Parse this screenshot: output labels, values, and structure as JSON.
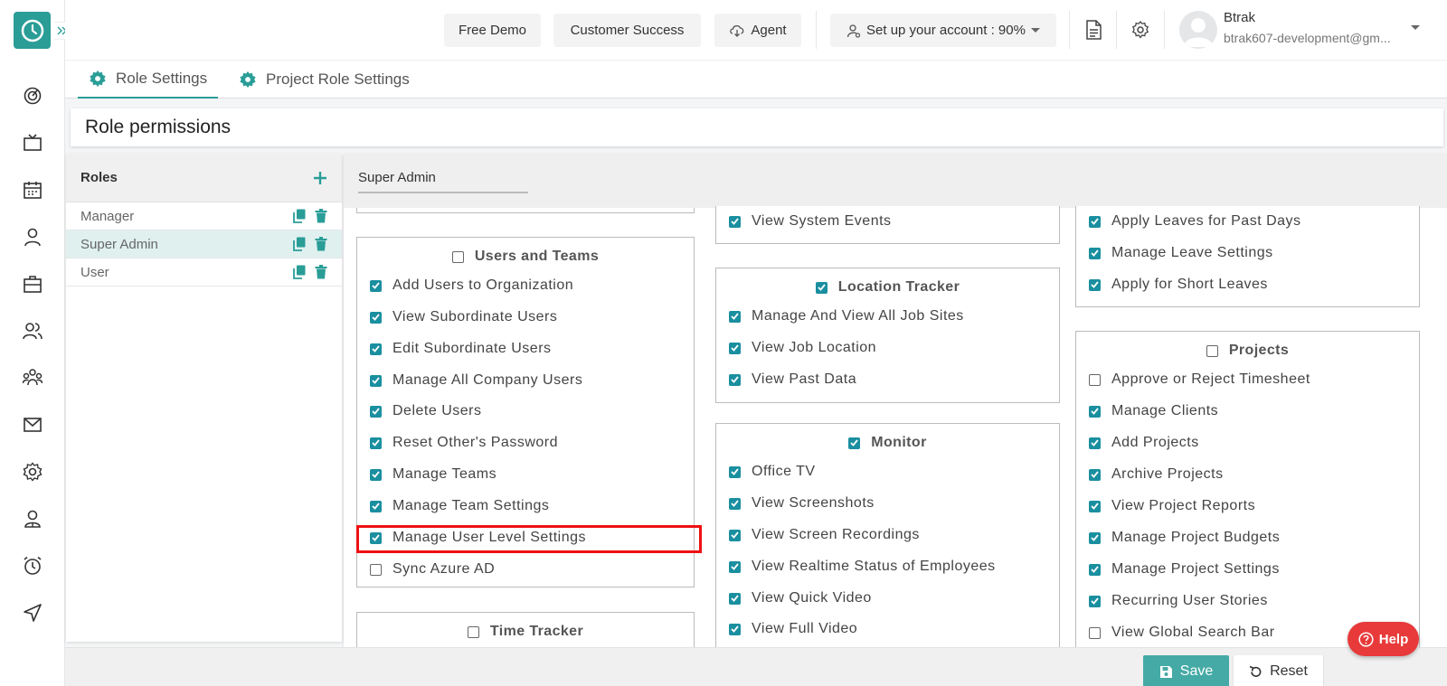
{
  "topbar": {
    "free_demo": "Free Demo",
    "customer_success": "Customer Success",
    "agent": "Agent",
    "setup": "Set up your account : 90%",
    "user_name": "Btrak",
    "user_email": "btrak607-development@gm..."
  },
  "tabs": [
    {
      "label": "Role Settings"
    },
    {
      "label": "Project Role Settings"
    }
  ],
  "page_title": "Role permissions",
  "roles": {
    "title": "Roles",
    "items": [
      {
        "label": "Manager"
      },
      {
        "label": "Super Admin"
      },
      {
        "label": "User"
      }
    ]
  },
  "selected_role": "Super Admin",
  "columns": {
    "col1": {
      "users_teams": {
        "title": "Users and Teams",
        "checked": false,
        "items": [
          {
            "label": "Add Users to Organization",
            "checked": true
          },
          {
            "label": "View Subordinate Users",
            "checked": true
          },
          {
            "label": "Edit Subordinate Users",
            "checked": true
          },
          {
            "label": "Manage All Company Users",
            "checked": true
          },
          {
            "label": "Delete Users",
            "checked": true
          },
          {
            "label": "Reset Other's Password",
            "checked": true
          },
          {
            "label": "Manage Teams",
            "checked": true
          },
          {
            "label": "Manage Team Settings",
            "checked": true
          },
          {
            "label": "Manage User Level Settings",
            "checked": true
          },
          {
            "label": "Sync Azure AD",
            "checked": false
          }
        ]
      },
      "time_tracker": {
        "title": "Time Tracker",
        "checked": false
      }
    },
    "col2": {
      "top_item": {
        "label": "View System Events",
        "checked": true
      },
      "location_tracker": {
        "title": "Location Tracker",
        "checked": true,
        "items": [
          {
            "label": "Manage And View All Job Sites",
            "checked": true
          },
          {
            "label": "View Job Location",
            "checked": true
          },
          {
            "label": "View Past Data",
            "checked": true
          }
        ]
      },
      "monitor": {
        "title": "Monitor",
        "checked": true,
        "items": [
          {
            "label": "Office TV",
            "checked": true
          },
          {
            "label": "View Screenshots",
            "checked": true
          },
          {
            "label": "View Screen Recordings",
            "checked": true
          },
          {
            "label": "View Realtime Status of Employees",
            "checked": true
          },
          {
            "label": "View Quick Video",
            "checked": true
          },
          {
            "label": "View Full Video",
            "checked": true
          }
        ]
      }
    },
    "col3": {
      "top_items": [
        {
          "label": "Apply Leaves for Past Days",
          "checked": true
        },
        {
          "label": "Manage Leave Settings",
          "checked": true
        },
        {
          "label": "Apply for Short Leaves",
          "checked": true
        }
      ],
      "projects": {
        "title": "Projects",
        "checked": false,
        "items": [
          {
            "label": "Approve or Reject Timesheet",
            "checked": false
          },
          {
            "label": "Manage Clients",
            "checked": true
          },
          {
            "label": "Add Projects",
            "checked": true
          },
          {
            "label": "Archive Projects",
            "checked": true
          },
          {
            "label": "View Project Reports",
            "checked": true
          },
          {
            "label": "Manage Project Budgets",
            "checked": true
          },
          {
            "label": "Manage Project Settings",
            "checked": true
          },
          {
            "label": "Recurring User Stories",
            "checked": true
          },
          {
            "label": "View Global Search Bar",
            "checked": false
          }
        ]
      }
    }
  },
  "footer": {
    "save": "Save",
    "reset": "Reset",
    "help": "Help"
  },
  "colors": {
    "accent": "#2a9d97",
    "checkbox": "#1a8fa0",
    "highlight": "#e11111",
    "help": "#e83a3a"
  }
}
